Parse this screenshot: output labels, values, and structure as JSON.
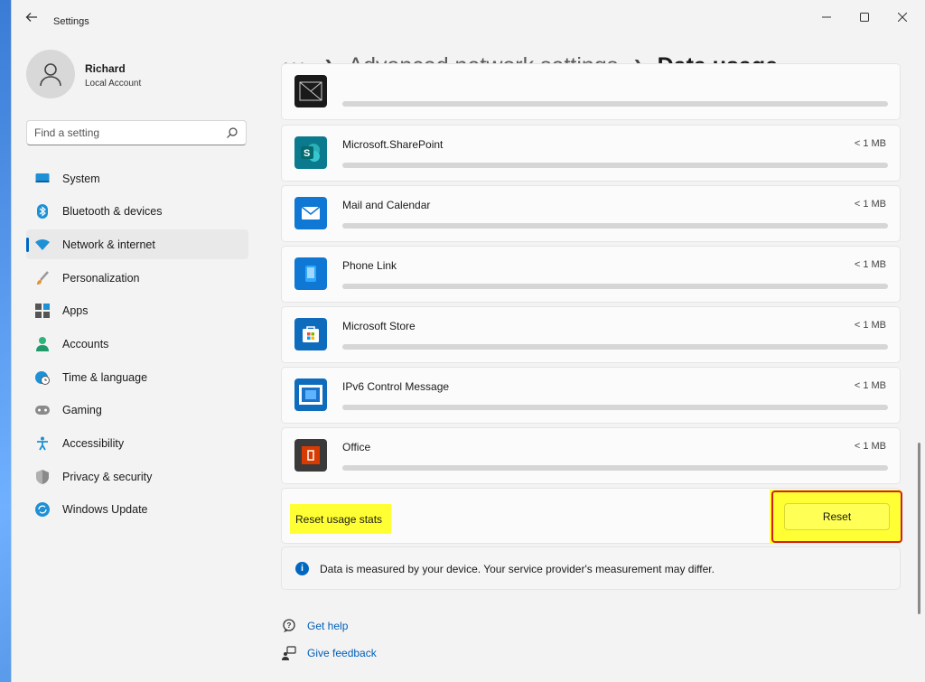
{
  "window": {
    "title": "Settings"
  },
  "profile": {
    "name": "Richard",
    "account_type": "Local Account"
  },
  "search": {
    "placeholder": "Find a setting"
  },
  "sidebar": {
    "items": [
      {
        "label": "System",
        "icon": "monitor-icon"
      },
      {
        "label": "Bluetooth & devices",
        "icon": "bluetooth-icon"
      },
      {
        "label": "Network & internet",
        "icon": "wifi-icon",
        "active": true
      },
      {
        "label": "Personalization",
        "icon": "brush-icon"
      },
      {
        "label": "Apps",
        "icon": "apps-icon"
      },
      {
        "label": "Accounts",
        "icon": "person-icon"
      },
      {
        "label": "Time & language",
        "icon": "globe-clock-icon"
      },
      {
        "label": "Gaming",
        "icon": "gamepad-icon"
      },
      {
        "label": "Accessibility",
        "icon": "accessibility-icon"
      },
      {
        "label": "Privacy & security",
        "icon": "shield-icon"
      },
      {
        "label": "Windows Update",
        "icon": "update-icon"
      }
    ]
  },
  "breadcrumb": {
    "more": "•••",
    "parent": "Advanced network settings",
    "current": "Data usage"
  },
  "apps": [
    {
      "name": "",
      "usage": "",
      "icon": "image-icon",
      "fill": 0
    },
    {
      "name": "Microsoft.SharePoint",
      "usage": "< 1 MB",
      "icon": "sharepoint-icon",
      "fill": 0
    },
    {
      "name": "Mail and Calendar",
      "usage": "< 1 MB",
      "icon": "mail-icon",
      "fill": 0
    },
    {
      "name": "Phone Link",
      "usage": "< 1 MB",
      "icon": "phone-icon",
      "fill": 0
    },
    {
      "name": "Microsoft Store",
      "usage": "< 1 MB",
      "icon": "store-icon",
      "fill": 0
    },
    {
      "name": "IPv6 Control Message",
      "usage": "< 1 MB",
      "icon": "ipv6-icon",
      "fill": 0
    },
    {
      "name": "Office",
      "usage": "< 1 MB",
      "icon": "office-icon",
      "fill": 0
    }
  ],
  "reset": {
    "label": "Reset usage stats",
    "button": "Reset"
  },
  "info": {
    "text": "Data is measured by your device. Your service provider's measurement may differ."
  },
  "help": {
    "get_help": "Get help",
    "give_feedback": "Give feedback"
  },
  "colors": {
    "accent": "#0067c0",
    "highlight": "#ffff33",
    "annotation": "#d02020"
  }
}
